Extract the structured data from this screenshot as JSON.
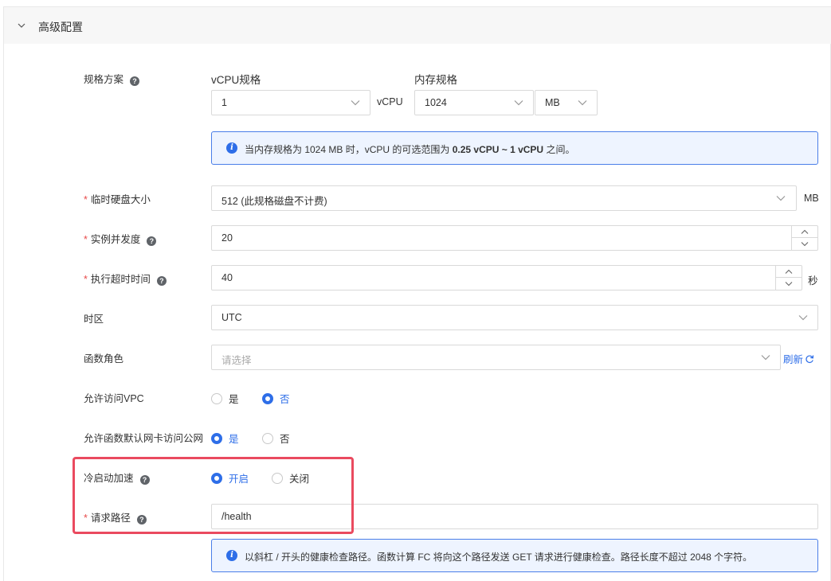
{
  "section_title": "高级配置",
  "spec": {
    "label": "规格方案",
    "vcpu_label": "vCPU规格",
    "vcpu_value": "1",
    "vcpu_unit": "vCPU",
    "mem_label": "内存规格",
    "mem_value": "1024",
    "mem_unit": "MB",
    "info_prefix": "当内存规格为 1024 MB 时，vCPU 的可选范围为 ",
    "info_range": "0.25 vCPU ~ 1 vCPU",
    "info_suffix": " 之间。"
  },
  "disk": {
    "label": "临时硬盘大小",
    "value": "512 (此规格磁盘不计费)",
    "unit": "MB"
  },
  "concurrency": {
    "label": "实例并发度",
    "value": "20"
  },
  "timeout": {
    "label": "执行超时时间",
    "value": "40",
    "unit": "秒"
  },
  "timezone": {
    "label": "时区",
    "value": "UTC"
  },
  "role": {
    "label": "函数角色",
    "placeholder": "请选择",
    "refresh": "刷新"
  },
  "vpc": {
    "label": "允许访问VPC",
    "yes": "是",
    "no": "否",
    "selected": "no"
  },
  "public_net": {
    "label": "允许函数默认网卡访问公网",
    "yes": "是",
    "no": "否",
    "selected": "yes"
  },
  "cold_start": {
    "label": "冷启动加速",
    "on": "开启",
    "off": "关闭",
    "selected": "on"
  },
  "path": {
    "label": "请求路径",
    "value": "/health",
    "info": "以斜杠 / 开头的健康检查路径。函数计算 FC 将向这个路径发送 GET 请求进行健康检查。路径长度不超过 2048 个字符。"
  },
  "colors": {
    "accent": "#2e6ee8",
    "required": "#e84a4a",
    "highlight": "#ea4a5f",
    "info_bg": "#eef4ff"
  }
}
